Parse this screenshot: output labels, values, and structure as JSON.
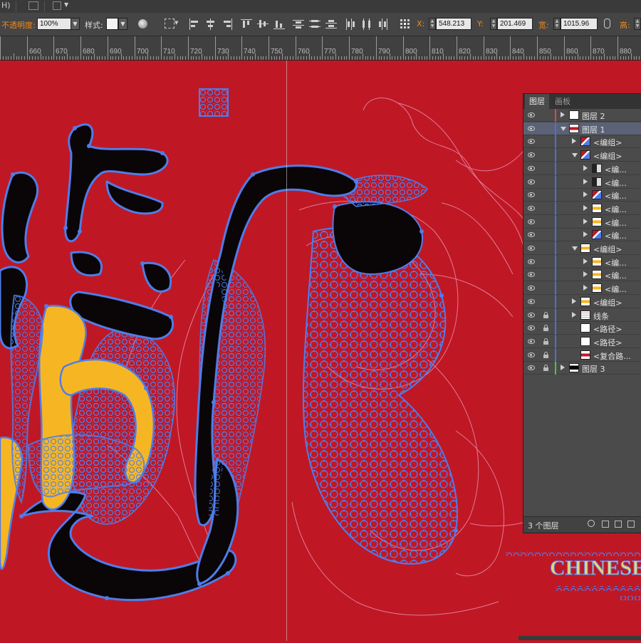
{
  "menubar": {
    "menu_fragment": "H)"
  },
  "control_bar": {
    "opacity_label": "不透明度:",
    "opacity_value": "100%",
    "style_label": "样式:",
    "x_label": "X:",
    "x_value": "548.213",
    "y_label": "Y:",
    "y_value": "201.469",
    "width_label": "宽:",
    "width_value": "1015.96",
    "height_label": "高:"
  },
  "ruler": {
    "labels": [
      "660",
      "670",
      "680",
      "690",
      "700",
      "710",
      "720",
      "730",
      "740",
      "750",
      "760",
      "770",
      "780",
      "790",
      "800",
      "810",
      "820",
      "830",
      "840",
      "850",
      "860",
      "870",
      "880"
    ]
  },
  "artwork": {
    "bg_color": "#c01725",
    "accent_blue": "#4f7de8",
    "accent_yellow": "#f6b623",
    "ink": "#0a0608",
    "chinese_text": "CHINESE"
  },
  "layers_panel": {
    "tabs": [
      "图层",
      "画板"
    ],
    "rows": [
      {
        "name": "图层 2",
        "color": "#e04848",
        "arrow": "right",
        "indent": 0,
        "thumb": "white",
        "lock": false,
        "selected": false
      },
      {
        "name": "图层 1",
        "color": "#4a6fe0",
        "arrow": "down",
        "indent": 0,
        "thumb": "red",
        "lock": false,
        "selected": true
      },
      {
        "name": "<编组>",
        "color": "#4a6fe0",
        "arrow": "right",
        "indent": 1,
        "thumb": "mix",
        "lock": false,
        "selected": false
      },
      {
        "name": "<编组>",
        "color": "#4a6fe0",
        "arrow": "down",
        "indent": 1,
        "thumb": "mix",
        "lock": false,
        "selected": false
      },
      {
        "name": "<编...",
        "color": "#4a6fe0",
        "arrow": "right",
        "indent": 2,
        "thumb": "dark",
        "lock": false,
        "selected": false
      },
      {
        "name": "<编...",
        "color": "#4a6fe0",
        "arrow": "right",
        "indent": 2,
        "thumb": "dark",
        "lock": false,
        "selected": false
      },
      {
        "name": "<编...",
        "color": "#4a6fe0",
        "arrow": "right",
        "indent": 2,
        "thumb": "mix",
        "lock": false,
        "selected": false
      },
      {
        "name": "<编...",
        "color": "#4a6fe0",
        "arrow": "right",
        "indent": 2,
        "thumb": "yellow",
        "lock": false,
        "selected": false
      },
      {
        "name": "<编...",
        "color": "#4a6fe0",
        "arrow": "right",
        "indent": 2,
        "thumb": "yellow",
        "lock": false,
        "selected": false
      },
      {
        "name": "<编...",
        "color": "#4a6fe0",
        "arrow": "right",
        "indent": 2,
        "thumb": "mix",
        "lock": false,
        "selected": false
      },
      {
        "name": "<编组>",
        "color": "#4a6fe0",
        "arrow": "down",
        "indent": 1,
        "thumb": "yellow",
        "lock": false,
        "selected": false
      },
      {
        "name": "<编...",
        "color": "#4a6fe0",
        "arrow": "right",
        "indent": 2,
        "thumb": "yellow",
        "lock": false,
        "selected": false
      },
      {
        "name": "<编...",
        "color": "#4a6fe0",
        "arrow": "right",
        "indent": 2,
        "thumb": "yellow",
        "lock": false,
        "selected": false
      },
      {
        "name": "<编...",
        "color": "#4a6fe0",
        "arrow": "right",
        "indent": 2,
        "thumb": "yellow",
        "lock": false,
        "selected": false
      },
      {
        "name": "<编组>",
        "color": "#4a6fe0",
        "arrow": "right",
        "indent": 1,
        "thumb": "yellow",
        "lock": false,
        "selected": false
      },
      {
        "name": "线条",
        "color": "#4a6fe0",
        "arrow": "right",
        "indent": 1,
        "thumb": "lines",
        "lock": true,
        "selected": false
      },
      {
        "name": "<路径>",
        "color": "#4a6fe0",
        "arrow": "none",
        "indent": 1,
        "thumb": "white",
        "lock": true,
        "selected": false
      },
      {
        "name": "<路径>",
        "color": "#4a6fe0",
        "arrow": "none",
        "indent": 1,
        "thumb": "white",
        "lock": true,
        "selected": false
      },
      {
        "name": "<复合路...",
        "color": "#4a6fe0",
        "arrow": "none",
        "indent": 1,
        "thumb": "red",
        "lock": true,
        "selected": false
      },
      {
        "name": "图层 3",
        "color": "#3ccf3c",
        "arrow": "right",
        "indent": 0,
        "thumb": "black",
        "lock": true,
        "selected": false
      }
    ],
    "footer_count": "3 个图层"
  }
}
